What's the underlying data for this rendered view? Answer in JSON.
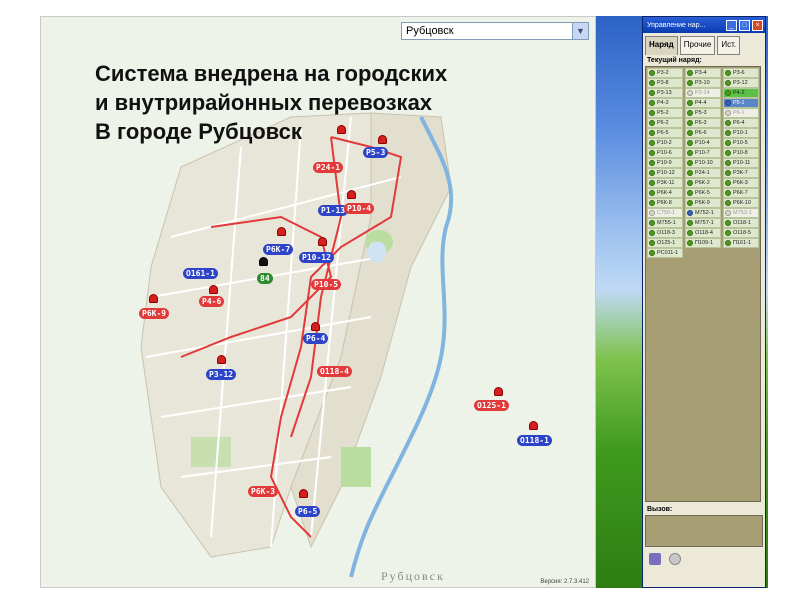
{
  "map": {
    "city_select": "Рубцовск",
    "headline_lines": [
      "Система внедрена на городских",
      "и внутрирайонных перевозках",
      "В городе Рубцовск"
    ],
    "caption": "Рубцовск",
    "version": "Версия: 2.7.3.412",
    "route_labels": [
      {
        "text": "Р24-1",
        "color": "red"
      },
      {
        "text": "Р5-3",
        "color": "blue"
      },
      {
        "text": "Р1-13",
        "color": "blue"
      },
      {
        "text": "Р10-4",
        "color": "red"
      },
      {
        "text": "Р6К-7",
        "color": "blue"
      },
      {
        "text": "Р10-12",
        "color": "blue"
      },
      {
        "text": "Р10-5",
        "color": "red"
      },
      {
        "text": "О161-1",
        "color": "blue"
      },
      {
        "text": "Р4-6",
        "color": "red"
      },
      {
        "text": "Р6К-9",
        "color": "red"
      },
      {
        "text": "Р3-12",
        "color": "blue"
      },
      {
        "text": "Р6-4",
        "color": "blue"
      },
      {
        "text": "О118-4",
        "color": "red"
      },
      {
        "text": "Р6К-3",
        "color": "red"
      },
      {
        "text": "Р6-5",
        "color": "blue"
      },
      {
        "text": "О125-1",
        "color": "red"
      },
      {
        "text": "О118-1",
        "color": "blue"
      },
      {
        "text": "84",
        "color": "green"
      }
    ]
  },
  "dispatch": {
    "title": "Управление нар...",
    "tabs": [
      "Наряд",
      "Прочие",
      "Ист."
    ],
    "current_label": "Текущий наряд:",
    "routes": [
      {
        "t": "Р3-2",
        "d": "g",
        "s": ""
      },
      {
        "t": "Р3-4",
        "d": "g",
        "s": ""
      },
      {
        "t": "Р3-6",
        "d": "g",
        "s": ""
      },
      {
        "t": "Р3-8",
        "d": "g",
        "s": ""
      },
      {
        "t": "Р3-10",
        "d": "g",
        "s": ""
      },
      {
        "t": "Р3-12",
        "d": "g",
        "s": ""
      },
      {
        "t": "Р3-13",
        "d": "g",
        "s": ""
      },
      {
        "t": "Р3-14",
        "d": "w",
        "s": "dim"
      },
      {
        "t": "Р4-2",
        "d": "g",
        "s": "hl"
      },
      {
        "t": "Р4-3",
        "d": "g",
        "s": ""
      },
      {
        "t": "Р4-4",
        "d": "g",
        "s": ""
      },
      {
        "t": "Р5-1",
        "d": "b",
        "s": "sel"
      },
      {
        "t": "Р5-2",
        "d": "g",
        "s": ""
      },
      {
        "t": "Р5-3",
        "d": "g",
        "s": ""
      },
      {
        "t": "Р6-1",
        "d": "w",
        "s": "dim"
      },
      {
        "t": "Р6-2",
        "d": "g",
        "s": ""
      },
      {
        "t": "Р6-3",
        "d": "g",
        "s": ""
      },
      {
        "t": "Р6-4",
        "d": "g",
        "s": ""
      },
      {
        "t": "Р6-5",
        "d": "g",
        "s": ""
      },
      {
        "t": "Р6-6",
        "d": "g",
        "s": ""
      },
      {
        "t": "Р10-1",
        "d": "g",
        "s": ""
      },
      {
        "t": "Р10-2",
        "d": "g",
        "s": ""
      },
      {
        "t": "Р10-4",
        "d": "g",
        "s": ""
      },
      {
        "t": "Р10-5",
        "d": "g",
        "s": ""
      },
      {
        "t": "Р10-6",
        "d": "g",
        "s": ""
      },
      {
        "t": "Р10-7",
        "d": "g",
        "s": ""
      },
      {
        "t": "Р10-8",
        "d": "g",
        "s": ""
      },
      {
        "t": "Р10-9",
        "d": "g",
        "s": ""
      },
      {
        "t": "Р10-10",
        "d": "g",
        "s": ""
      },
      {
        "t": "Р10-11",
        "d": "g",
        "s": ""
      },
      {
        "t": "Р10-12",
        "d": "g",
        "s": ""
      },
      {
        "t": "Р24-1",
        "d": "g",
        "s": ""
      },
      {
        "t": "Р3К-7",
        "d": "g",
        "s": ""
      },
      {
        "t": "Р3К-11",
        "d": "g",
        "s": ""
      },
      {
        "t": "Р6К-2",
        "d": "g",
        "s": ""
      },
      {
        "t": "Р6К-3",
        "d": "g",
        "s": ""
      },
      {
        "t": "Р6К-4",
        "d": "g",
        "s": ""
      },
      {
        "t": "Р6К-5",
        "d": "g",
        "s": ""
      },
      {
        "t": "Р6К-7",
        "d": "g",
        "s": ""
      },
      {
        "t": "Р6К-8",
        "d": "g",
        "s": ""
      },
      {
        "t": "Р6К-9",
        "d": "g",
        "s": ""
      },
      {
        "t": "Р6К-10",
        "d": "g",
        "s": ""
      },
      {
        "t": "С750-1",
        "d": "w",
        "s": "dim"
      },
      {
        "t": "М752-1",
        "d": "b",
        "s": ""
      },
      {
        "t": "М753-1",
        "d": "w",
        "s": "dim"
      },
      {
        "t": "М755-1",
        "d": "g",
        "s": ""
      },
      {
        "t": "М757-1",
        "d": "g",
        "s": ""
      },
      {
        "t": "О118-1",
        "d": "g",
        "s": ""
      },
      {
        "t": "О118-3",
        "d": "g",
        "s": ""
      },
      {
        "t": "О118-4",
        "d": "g",
        "s": ""
      },
      {
        "t": "О118-5",
        "d": "g",
        "s": ""
      },
      {
        "t": "О125-1",
        "d": "g",
        "s": ""
      },
      {
        "t": "П109-1",
        "d": "g",
        "s": ""
      },
      {
        "t": "П161-1",
        "d": "g",
        "s": ""
      },
      {
        "t": "РС011-1",
        "d": "g",
        "s": ""
      }
    ],
    "call_label": "Вызов:"
  }
}
